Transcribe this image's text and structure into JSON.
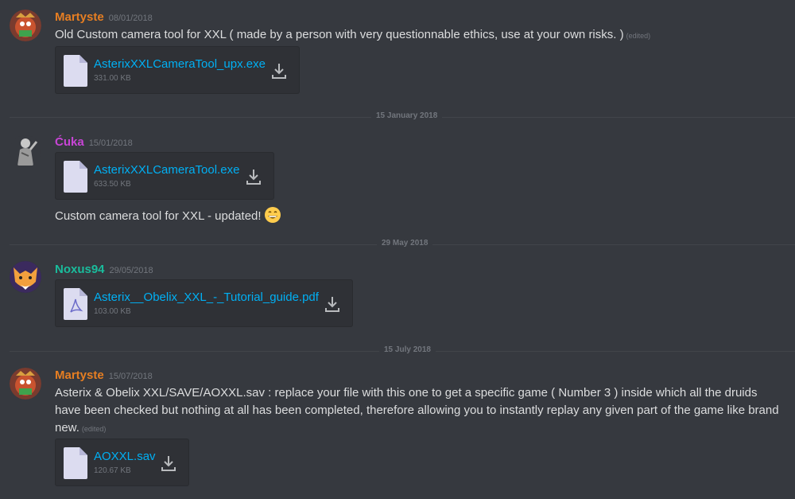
{
  "messages": [
    {
      "author": "Martyste",
      "author_color": "#e67e22",
      "timestamp": "08/01/2018",
      "text": "Old Custom camera tool for XXL ( made by a person with very questionnable ethics, use at your own risks. )",
      "edited": "(edited)",
      "attachment": {
        "name": "AsterixXXLCameraTool_upx.exe",
        "size": "331.00 KB",
        "icon": "file-icon"
      }
    },
    {
      "author": "Ćuka",
      "author_color": "#c845d6",
      "timestamp": "15/01/2018",
      "attachment": {
        "name": "AsterixXXLCameraTool.exe",
        "size": "633.50 KB",
        "icon": "file-icon"
      },
      "text": "Custom camera tool for XXL - updated!",
      "emoji": "grinning-face-emoji"
    },
    {
      "author": "Noxus94",
      "author_color": "#1abc9c",
      "timestamp": "29/05/2018",
      "attachment": {
        "name": "Asterix__Obelix_XXL_-_Tutorial_guide.pdf",
        "size": "103.00 KB",
        "icon": "pdf-icon"
      }
    },
    {
      "author": "Martyste",
      "author_color": "#e67e22",
      "timestamp": "15/07/2018",
      "text_lines": [
        "Asterix & Obelix XXL/SAVE/AOXXL.sav : replace your file with this one to get a specific game ( Number 3 ) inside which all the druids",
        "have been checked but nothing at all has been completed, therefore allowing you to instantly replay any given part of the game like brand",
        "new."
      ],
      "edited": "(edited)",
      "attachment": {
        "name": "AOXXL.sav",
        "size": "120.67 KB",
        "icon": "file-icon"
      }
    }
  ],
  "dividers": [
    "15 January 2018",
    "29 May 2018",
    "15 July 2018"
  ],
  "colors": {
    "background": "#36393f",
    "link": "#00b0f4",
    "muted": "#72767d",
    "attachment_bg": "#2f3136"
  }
}
